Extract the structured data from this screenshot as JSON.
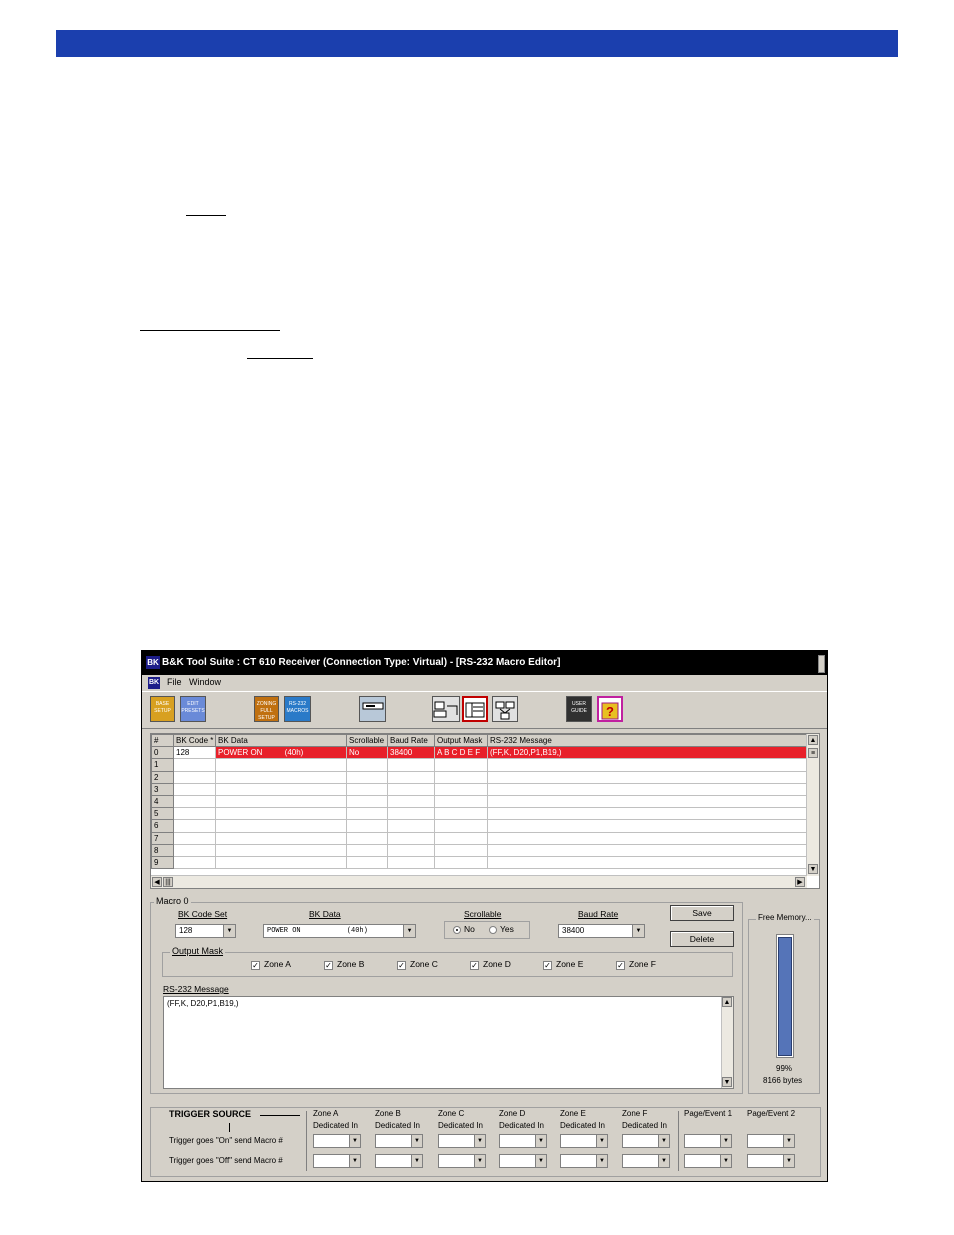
{
  "window": {
    "title": "B&K Tool Suite : CT 610 Receiver (Connection Type: Virtual) - [RS-232 Macro Editor]",
    "logo": "BK"
  },
  "menu": {
    "file": "File",
    "window": "Window"
  },
  "toolbar": {
    "buttons": [
      {
        "label": "BASE SETUP",
        "color": "#d8a020"
      },
      {
        "label": "EDIT PRESETS",
        "color": "#6a8ad8"
      },
      {
        "label": "ZONING FULL SETUP",
        "color": "#c07010"
      },
      {
        "label": "RS-232 MACROS",
        "color": "#2a7ac8"
      },
      {
        "label": "UPLOAD",
        "color": "#b8c8d8"
      },
      {
        "label": "NETWORK",
        "color": "#e0e0e0"
      },
      {
        "label": "USER GUIDE",
        "color": "#303030"
      },
      {
        "label": "HELP",
        "color": "#d020a0"
      }
    ]
  },
  "grid": {
    "columns": [
      "#",
      "BK Code *",
      "BK Data",
      "Scrollable",
      "Baud Rate",
      "Output Mask",
      "RS-232 Message"
    ],
    "rows": [
      [
        "0",
        "128",
        "POWER ON          (40h)",
        "No",
        "38400",
        "A B C D E F",
        "(FF,K, D20,P1,B19,)"
      ],
      [
        "1",
        "",
        "",
        "",
        "",
        "",
        ""
      ],
      [
        "2",
        "",
        "",
        "",
        "",
        "",
        ""
      ],
      [
        "3",
        "",
        "",
        "",
        "",
        "",
        ""
      ],
      [
        "4",
        "",
        "",
        "",
        "",
        "",
        ""
      ],
      [
        "5",
        "",
        "",
        "",
        "",
        "",
        ""
      ],
      [
        "6",
        "",
        "",
        "",
        "",
        "",
        ""
      ],
      [
        "7",
        "",
        "",
        "",
        "",
        "",
        ""
      ],
      [
        "8",
        "",
        "",
        "",
        "",
        "",
        ""
      ],
      [
        "9",
        "",
        "",
        "",
        "",
        "",
        ""
      ]
    ],
    "selected_row": 0,
    "selection_color": "#e8202a"
  },
  "macro": {
    "group_label": "Macro 0",
    "bk_code_set_label": "BK Code Set",
    "bk_code_set_value": "128",
    "bk_data_label": "BK Data",
    "bk_data_value": "POWER ON           (40h)",
    "scrollable_label": "Scrollable",
    "radio_no": "No",
    "radio_yes": "Yes",
    "baud_rate_label": "Baud Rate",
    "baud_rate_value": "38400",
    "save_label": "Save",
    "delete_label": "Delete",
    "output_mask_label": "Output Mask",
    "zones": [
      "Zone A",
      "Zone B",
      "Zone C",
      "Zone D",
      "Zone E",
      "Zone F"
    ],
    "rs232_label": "RS-232 Message",
    "rs232_value": "(FF,K, D20,P1,B19,)"
  },
  "memory": {
    "label": "Free Memory...",
    "percent_text": "99%",
    "bytes_text": "8166 bytes",
    "fill_fraction": 0.99
  },
  "trigger": {
    "title": "TRIGGER SOURCE",
    "on_label": "Trigger goes \"On\" send Macro #",
    "off_label": "Trigger goes \"Off\" send Macro #",
    "columns": [
      {
        "line1": "Zone A",
        "line2": "Dedicated In"
      },
      {
        "line1": "Zone B",
        "line2": "Dedicated In"
      },
      {
        "line1": "Zone C",
        "line2": "Dedicated In"
      },
      {
        "line1": "Zone D",
        "line2": "Dedicated In"
      },
      {
        "line1": "Zone E",
        "line2": "Dedicated In"
      },
      {
        "line1": "Zone F",
        "line2": "Dedicated In"
      },
      {
        "line1": "Page/Event 1",
        "line2": ""
      },
      {
        "line1": "Page/Event 2",
        "line2": ""
      }
    ]
  }
}
